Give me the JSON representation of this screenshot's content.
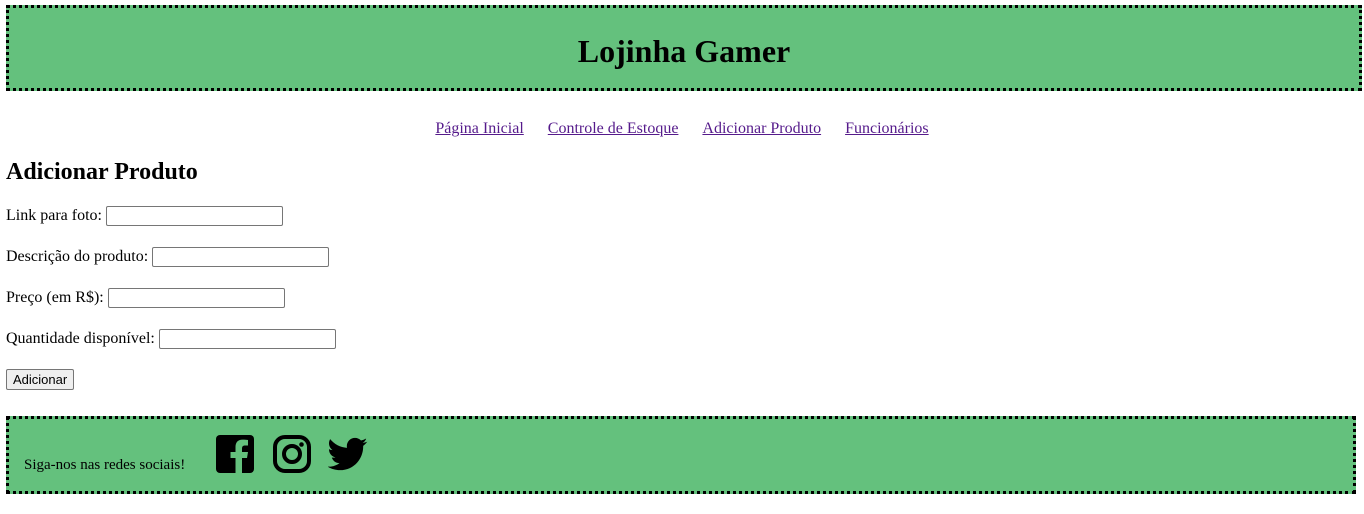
{
  "header": {
    "title": "Lojinha Gamer",
    "bg_color": "#64c17d"
  },
  "nav": {
    "items": [
      {
        "label": "Página Inicial"
      },
      {
        "label": "Controle de Estoque"
      },
      {
        "label": "Adicionar Produto"
      },
      {
        "label": "Funcionários"
      }
    ],
    "link_color": "#551a8b"
  },
  "main": {
    "title": "Adicionar Produto",
    "fields": [
      {
        "label": "Link para foto:",
        "value": ""
      },
      {
        "label": "Descrição do produto:",
        "value": ""
      },
      {
        "label": "Preço (em R$):",
        "value": ""
      },
      {
        "label": "Quantidade disponível:",
        "value": ""
      }
    ],
    "submit_label": "Adicionar"
  },
  "footer": {
    "text": "Siga-nos nas redes sociais!",
    "icons": [
      "facebook-icon",
      "instagram-icon",
      "twitter-icon"
    ]
  }
}
